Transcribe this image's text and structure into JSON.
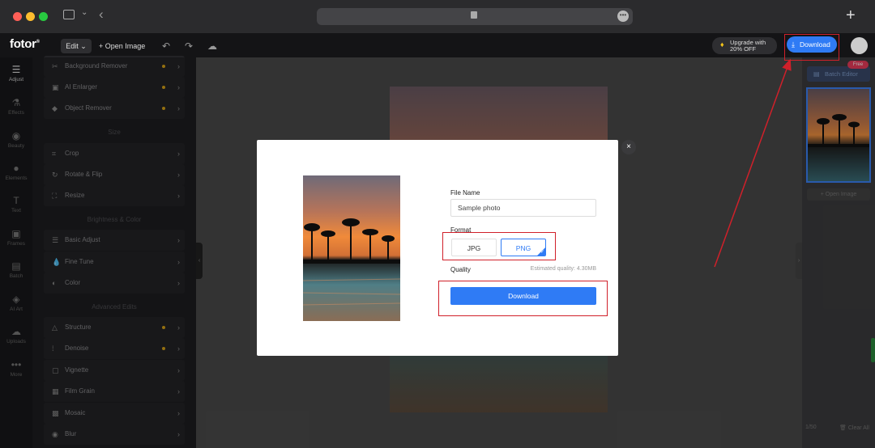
{
  "browser": {
    "url_menu_icon": "ellipsis-icon",
    "new_tab_label": "+",
    "colors": {
      "close": "#ff5f57",
      "minimize": "#febc2e",
      "maximize": "#28c840"
    }
  },
  "app": {
    "logo": "fotor",
    "logo_mark": "®",
    "edit_label": "Edit",
    "open_image_label": "+ Open Image",
    "upgrade_line1": "Upgrade with",
    "upgrade_line2": "20% OFF",
    "download_label": "Download",
    "accent": "#2f7bf5"
  },
  "rail": [
    {
      "label": "Adjust",
      "icon": "sliders-icon",
      "glyph": "☰"
    },
    {
      "label": "Effects",
      "icon": "flask-icon",
      "glyph": "⚗"
    },
    {
      "label": "Beauty",
      "icon": "eye-icon",
      "glyph": "◉"
    },
    {
      "label": "Elements",
      "icon": "shapes-icon",
      "glyph": "●"
    },
    {
      "label": "Text",
      "icon": "text-icon",
      "glyph": "T"
    },
    {
      "label": "Frames",
      "icon": "frame-icon",
      "glyph": "▣"
    },
    {
      "label": "Batch",
      "icon": "batch-icon",
      "glyph": "▤"
    },
    {
      "label": "AI Art",
      "icon": "ai-art-icon",
      "glyph": "◈"
    },
    {
      "label": "Uploads",
      "icon": "upload-icon",
      "glyph": "☁"
    },
    {
      "label": "More",
      "icon": "more-icon",
      "glyph": "•••"
    }
  ],
  "panel": {
    "tools_top": [
      {
        "label": "Background Remover",
        "icon": "scissors-icon",
        "glyph": "✂"
      },
      {
        "label": "AI Enlarger",
        "icon": "enlarge-icon",
        "glyph": "▣"
      },
      {
        "label": "Object Remover",
        "icon": "eraser-icon",
        "glyph": "◆"
      }
    ],
    "section_size": "Size",
    "tools_size": [
      {
        "label": "Crop",
        "icon": "crop-icon",
        "glyph": "⌗"
      },
      {
        "label": "Rotate & Flip",
        "icon": "rotate-icon",
        "glyph": "↻"
      },
      {
        "label": "Resize",
        "icon": "resize-icon",
        "glyph": "⛶"
      }
    ],
    "section_brightness": "Brightness & Color",
    "tools_brightness": [
      {
        "label": "Basic Adjust",
        "icon": "sliders-icon",
        "glyph": "☰"
      },
      {
        "label": "Fine Tune",
        "icon": "drop-icon",
        "glyph": "💧"
      },
      {
        "label": "Color",
        "icon": "color-icon",
        "glyph": "◐"
      }
    ],
    "section_advanced": "Advanced Edits",
    "tools_advanced": [
      {
        "label": "Structure",
        "icon": "triangle-icon",
        "glyph": "△"
      },
      {
        "label": "Denoise",
        "icon": "denoise-icon",
        "glyph": "⁞"
      },
      {
        "label": "Vignette",
        "icon": "vignette-icon",
        "glyph": "▢"
      },
      {
        "label": "Film Grain",
        "icon": "grain-icon",
        "glyph": "▦"
      },
      {
        "label": "Mosaic",
        "icon": "mosaic-icon",
        "glyph": "▩"
      },
      {
        "label": "Blur",
        "icon": "blur-icon",
        "glyph": "◉"
      }
    ]
  },
  "right": {
    "free_badge": "Free",
    "batch_editor_label": "Batch Editor",
    "open_image_label": "Open Image",
    "pager": "1/50",
    "clear_all_label": "Clear All"
  },
  "modal": {
    "file_name_label": "File Name",
    "file_name_value": "Sample photo",
    "format_label": "Format",
    "format_options": [
      "JPG",
      "PNG"
    ],
    "selected_format": "PNG",
    "quality_label": "Quality",
    "estimated_quality": "Estimated quality: 4.30MB",
    "download_label": "Download"
  }
}
